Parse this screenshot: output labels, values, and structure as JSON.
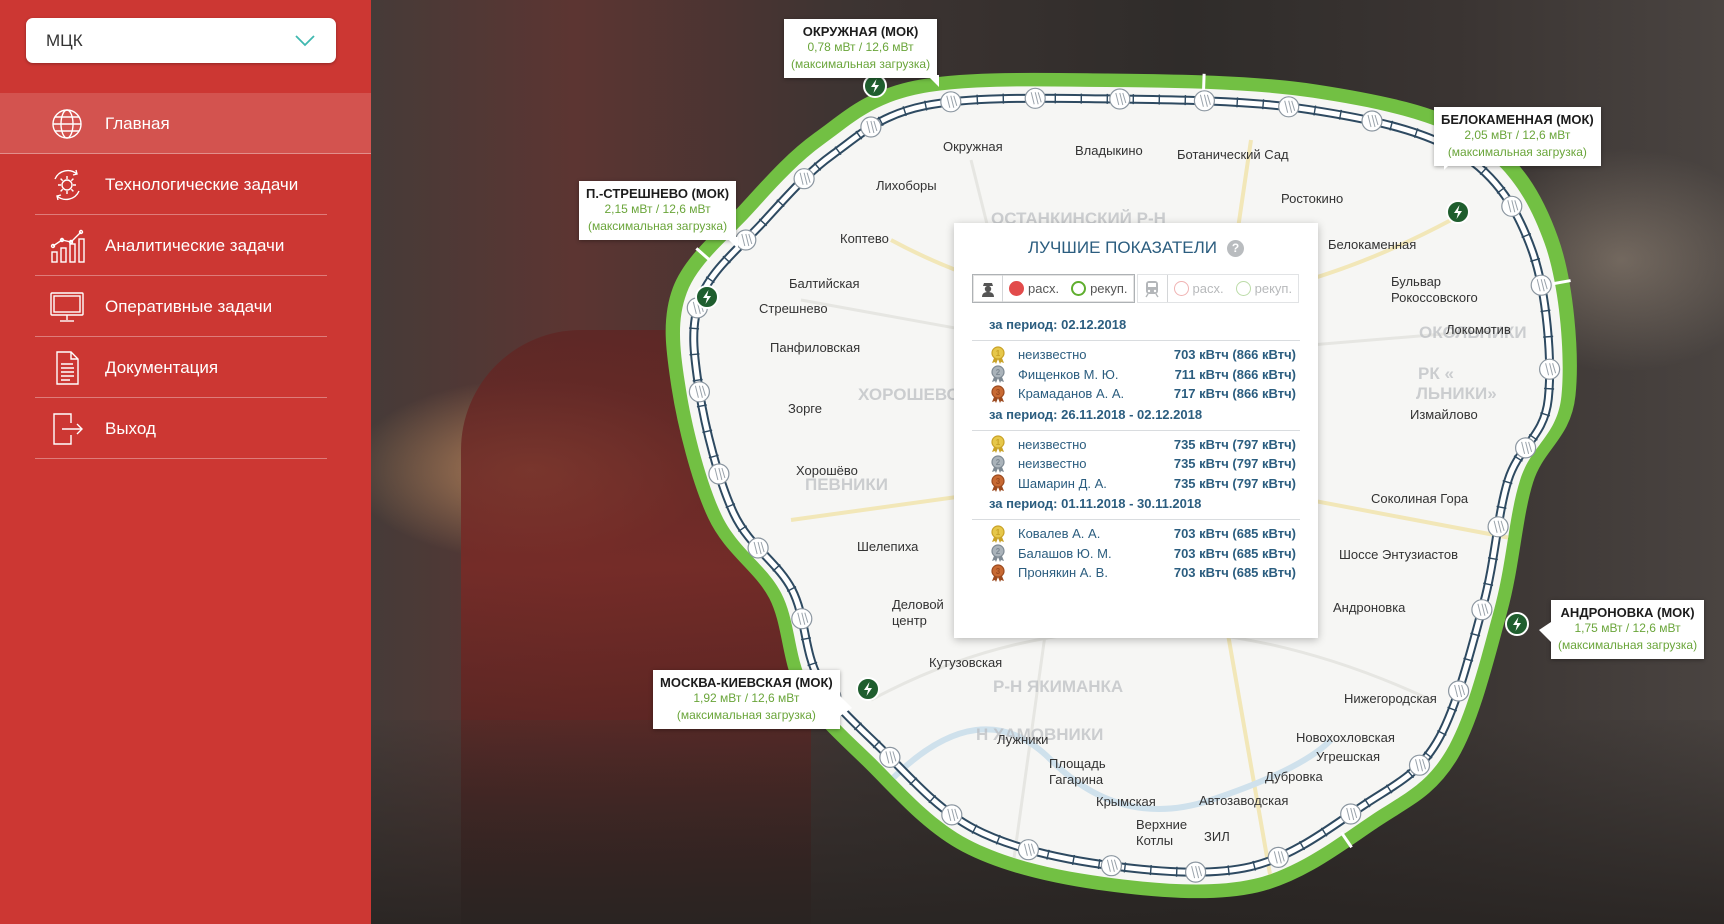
{
  "sidebar": {
    "select_value": "МЦК",
    "menu": [
      {
        "label": "Главная",
        "icon": "globe-icon",
        "active": true
      },
      {
        "label": "Технологические задачи",
        "icon": "gear-cycle-icon"
      },
      {
        "label": "Аналитические задачи",
        "icon": "analytics-chart-icon"
      },
      {
        "label": "Оперативные задачи",
        "icon": "monitor-icon"
      },
      {
        "label": "Документация",
        "icon": "document-icon"
      },
      {
        "label": "Выход",
        "icon": "exit-icon"
      }
    ]
  },
  "map": {
    "districts": [
      "ОСТАНКИНСКИЙ Р-Н",
      "ХОРОШЕВСКИЙ",
      "ПЕВНИКИ",
      "Р-Н ЯКИМАНКА",
      "Н ХАМОВНИКИ",
      "ОКОЛЬНИКИ",
      "РК «",
      "ЛЬНИКИ»"
    ],
    "stations": [
      "Окружная",
      "Владыкино",
      "Ботанический Сад",
      "Ростокино",
      "Белокаменная",
      "Бульвар Рокоссовского",
      "Локомотив",
      "Измайлово",
      "Соколиная Гора",
      "Шоссе Энтузиастов",
      "Андроновка",
      "Нижегородская",
      "Новохохловская",
      "Угрешская",
      "Дубровка",
      "Автозаводская",
      "ЗИЛ",
      "Верхние Котлы",
      "Крымская",
      "Площадь Гагарина",
      "Лужники",
      "Кутузовская",
      "Деловой центр",
      "Шелепиха",
      "Хорошёво",
      "Зорге",
      "Панфиловская",
      "Стрешнево",
      "Балтийская",
      "Коптево",
      "Лихоборы"
    ]
  },
  "substations": [
    {
      "title": "ОКРУЖНАЯ (МОК)",
      "line1": "0,78 мВт / 12,6 мВт",
      "line2": "(максимальная загрузка)"
    },
    {
      "title": "БЕЛОКАМЕННАЯ (МОК)",
      "line1": "2,05 мВт / 12,6 мВт",
      "line2": "(максимальная загрузка)"
    },
    {
      "title": "П.-СТРЕШНЕВО (МОК)",
      "line1": "2,15 мВт / 12,6 мВт",
      "line2": "(максимальная загрузка)"
    },
    {
      "title": "АНДРОНОВКА (МОК)",
      "line1": "1,75 мВт / 12,6 мВт",
      "line2": "(максимальная загрузка)"
    },
    {
      "title": "МОСКВА-КИЕВСКАЯ (МОК)",
      "line1": "1,92 мВт / 12,6 мВт",
      "line2": "(максимальная загрузка)"
    }
  ],
  "best": {
    "title": "ЛУЧШИЕ ПОКАЗАТЕЛИ",
    "help": "?",
    "filter_driver": {
      "spend": "расх.",
      "recup": "рекуп."
    },
    "filter_train": {
      "spend": "расх.",
      "recup": "рекуп."
    },
    "periods": [
      {
        "title": "за период: 02.12.2018",
        "rows": [
          {
            "name": "неизвестно",
            "value": "703 кВтч (866 кВтч)"
          },
          {
            "name": "Фищенков М. Ю.",
            "value": "711 кВтч (866 кВтч)"
          },
          {
            "name": "Крамаданов А. А.",
            "value": "717 кВтч (866 кВтч)"
          }
        ]
      },
      {
        "title": "за период: 26.11.2018 - 02.12.2018",
        "rows": [
          {
            "name": "неизвестно",
            "value": "735 кВтч (797 кВтч)"
          },
          {
            "name": "неизвестно",
            "value": "735 кВтч (797 кВтч)"
          },
          {
            "name": "Шамарин Д. А.",
            "value": "735 кВтч (797 кВтч)"
          }
        ]
      },
      {
        "title": "за период: 01.11.2018 - 30.11.2018",
        "rows": [
          {
            "name": "Ковалев А. А.",
            "value": "703 кВтч (685 кВтч)"
          },
          {
            "name": "Балашов Ю. М.",
            "value": "703 кВтч (685 кВтч)"
          },
          {
            "name": "Пронякин А. В.",
            "value": "703 кВтч (685 кВтч)"
          }
        ]
      }
    ]
  },
  "colors": {
    "sidebar": "#cc3733",
    "ring_green": "#72c043",
    "track": "#2e4a61",
    "label_green": "#6aa53a",
    "text_blue": "#2b5d7f"
  }
}
